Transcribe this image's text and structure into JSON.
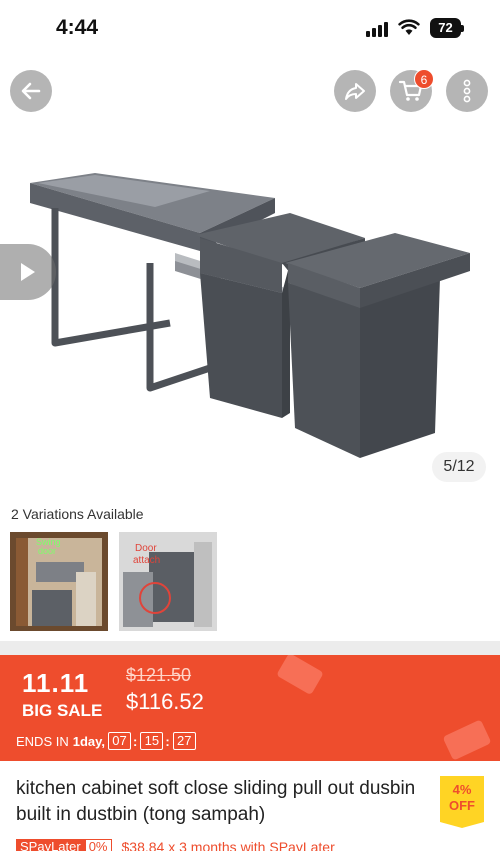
{
  "status_bar": {
    "time": "4:44",
    "battery": "72"
  },
  "gallery": {
    "cart_count": "6",
    "image_counter": "5/12"
  },
  "variations": {
    "title": "2 Variations Available",
    "thumbs": [
      {
        "label_line1": "Swing",
        "label_line2": "door"
      },
      {
        "label_line1": "Door",
        "label_line2": "attach"
      }
    ]
  },
  "sale": {
    "logo_numbers": "11.11",
    "logo_text": "BIG SALE",
    "original_price": "$121.50",
    "sale_price": "$116.52",
    "ends_in_label": "ENDS IN",
    "ends_in_days": "1day,",
    "timer": [
      "07",
      "15",
      "27"
    ]
  },
  "product": {
    "title": "kitchen cabinet soft close sliding pull out dusbin built in dustbin (tong sampah)",
    "discount_percent": "4%",
    "discount_label": "OFF"
  },
  "spaylater": {
    "label": "SPayLater",
    "rate": "0%",
    "installment_text": "$38.84 x 3 months with SPayLater"
  },
  "colors": {
    "accent": "#ee4d2d",
    "badge_yellow": "#ffd424"
  },
  "icons": [
    "back-arrow-icon",
    "share-icon",
    "cart-icon",
    "more-icon",
    "play-icon",
    "signal-icon",
    "wifi-icon",
    "battery-icon"
  ]
}
